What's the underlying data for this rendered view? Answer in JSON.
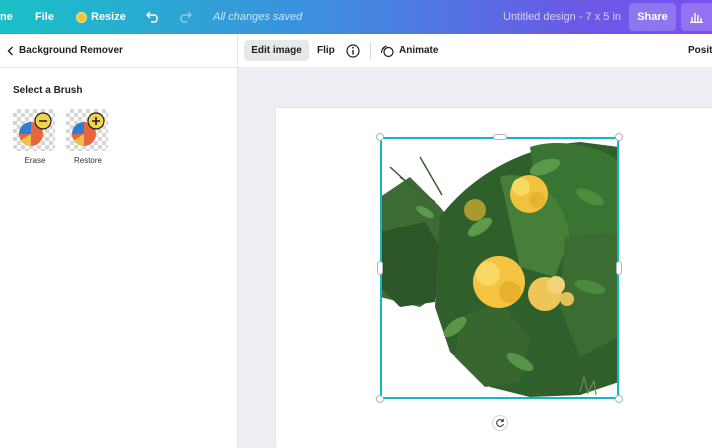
{
  "topbar": {
    "home_label": "ne",
    "file_label": "File",
    "resize_label": "Resize",
    "saved_status": "All changes saved",
    "design_title": "Untitled design - 7 x 5 in",
    "share_label": "Share"
  },
  "left_panel": {
    "back_label": "Background Remover",
    "section_title": "Select a Brush",
    "brushes": [
      {
        "label": "Erase",
        "icon": "minus-circle-icon"
      },
      {
        "label": "Restore",
        "icon": "plus-circle-icon"
      }
    ]
  },
  "toolbar": {
    "edit_image_label": "Edit image",
    "flip_label": "Flip",
    "animate_label": "Animate",
    "position_label": "Positi"
  },
  "colors": {
    "selection": "#14b8c4",
    "topbar_gradient_start": "#19c1c6",
    "topbar_gradient_end": "#7a4ff0"
  }
}
